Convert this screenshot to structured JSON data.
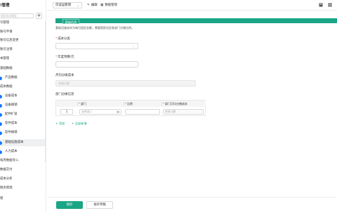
{
  "sidebar": {
    "title": "!管理",
    "search_placeholder": "搜索成本模板",
    "add_symbol": "+",
    "items": [
      {
        "label": "号管理",
        "child": false,
        "active": false,
        "dot": false
      },
      {
        "label": "账号申请",
        "child": false,
        "active": false,
        "dot": false
      },
      {
        "label": "账号信息变更",
        "child": false,
        "active": false,
        "dot": false
      },
      {
        "label": "账号注销",
        "child": false,
        "active": false,
        "dot": false
      },
      {
        "label": "本管理",
        "child": false,
        "active": false,
        "dot": false
      },
      {
        "label": "基础数据",
        "child": false,
        "active": false,
        "dot": false
      },
      {
        "label": "产品数据",
        "child": true,
        "active": false,
        "dot": true
      },
      {
        "label": "成本数据",
        "child": false,
        "active": false,
        "dot": false
      },
      {
        "label": "设备成本",
        "child": true,
        "active": false,
        "dot": true
      },
      {
        "label": "设备摊销",
        "child": true,
        "active": false,
        "dot": true
      },
      {
        "label": "配件扩容",
        "child": true,
        "active": false,
        "dot": true
      },
      {
        "label": "软件成本",
        "child": true,
        "active": false,
        "dot": true
      },
      {
        "label": "软件摊销",
        "child": true,
        "active": false,
        "dot": true
      },
      {
        "label": "基础设施成本",
        "child": true,
        "active": true,
        "dot": true
      },
      {
        "label": "人力成本",
        "child": true,
        "active": false,
        "dot": true
      },
      {
        "label": "每月数据导入",
        "child": false,
        "active": false,
        "dot": false
      },
      {
        "label": "数据交付",
        "child": false,
        "active": false,
        "dot": false
      },
      {
        "label": "成本分析",
        "child": false,
        "active": false,
        "dot": false
      },
      {
        "label": "税务管理",
        "child": false,
        "active": false,
        "dot": false
      },
      {
        "label": "理",
        "child": false,
        "active": false,
        "dot": false
      }
    ]
  },
  "toolbar": {
    "select_value": "仅读运管理",
    "edit_label": "编辑",
    "data_manage_label": "数据管理",
    "edit_icon": "pencil-icon",
    "data_icon": "grid-icon"
  },
  "main": {
    "section_label": "基础信息",
    "description": "基础设施成本为每月固定金额，需要提前设定各部门分摊比例。",
    "fields": {
      "cost_category": {
        "label": "成本分类",
        "required": true
      },
      "annual_budget": {
        "label": "年度预算/元",
        "required": true
      },
      "amortized": {
        "label": "月均分摊成本",
        "required": false,
        "placeholder": "系统计算"
      },
      "dept_share": {
        "label": "部门分摊信息",
        "required": false
      }
    },
    "table": {
      "headers": {
        "dept": "部门",
        "ratio": "比例",
        "monthly": "部门月均分摊成本"
      },
      "row": {
        "index": "1",
        "dept_placeholder": "选择部门",
        "monthly_placeholder": "系统计算"
      }
    },
    "add_label": "添加",
    "add_all_label": "全部新增",
    "primary_button": "保存",
    "secondary_button": "保存草稿"
  },
  "colors": {
    "accent": "#1aa686",
    "link": "#1677ff"
  }
}
